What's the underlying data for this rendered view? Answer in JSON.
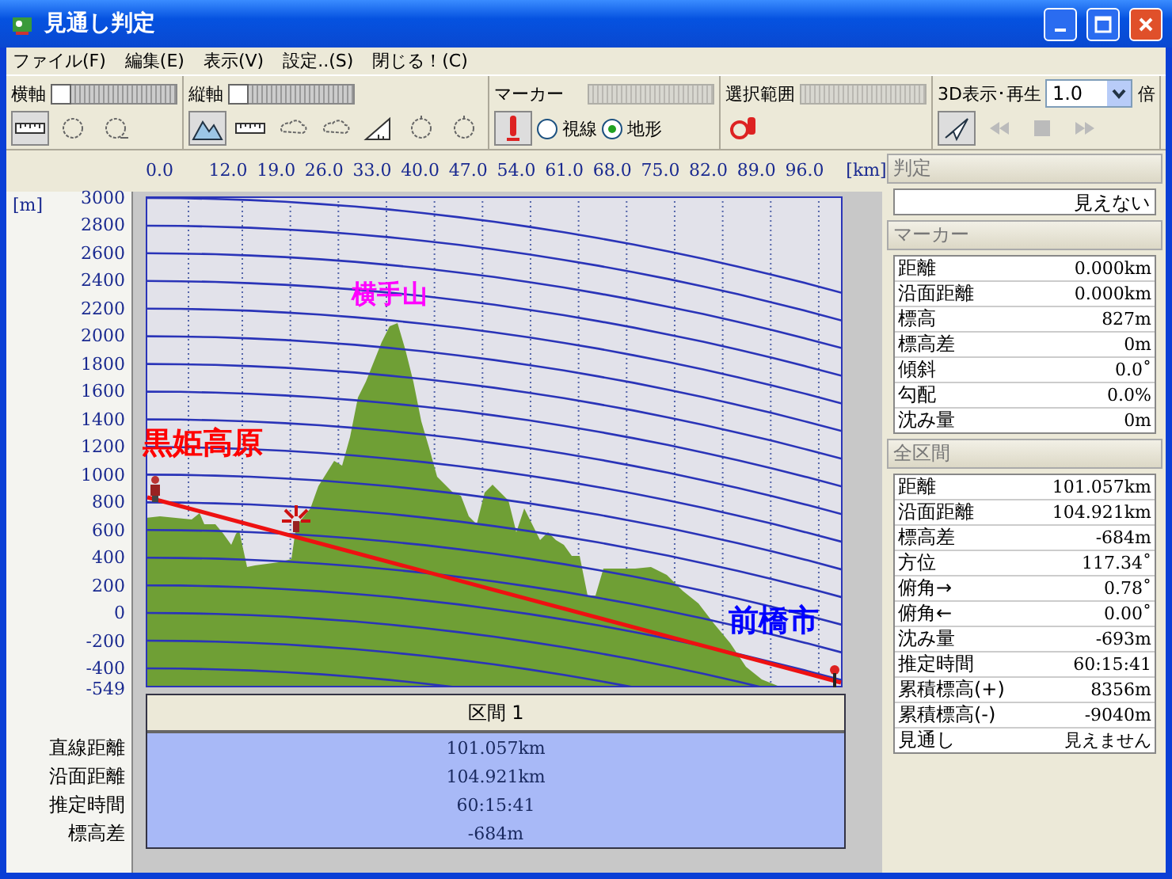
{
  "window": {
    "title": "見通し判定"
  },
  "menu": [
    {
      "label": "ファイル(F)"
    },
    {
      "label": "編集(E)"
    },
    {
      "label": "表示(V)"
    },
    {
      "label": "設定..(S)"
    },
    {
      "label": "閉じる！(C)"
    }
  ],
  "toolbar": {
    "horizontal_axis": {
      "label": "横軸",
      "level": 0
    },
    "vertical_axis": {
      "label": "縦軸",
      "level": 0
    },
    "marker": {
      "label": "マーカー",
      "disabled": true,
      "options": [
        {
          "label": "視線",
          "selected": false
        },
        {
          "label": "地形",
          "selected": true
        }
      ]
    },
    "selection": {
      "label": "選択範囲",
      "disabled": true
    },
    "playback": {
      "label": "3D表示･再生",
      "speed": "1.0",
      "unit": "倍"
    }
  },
  "profile": {
    "x_ticks": [
      "0.0",
      "12.0",
      "19.0",
      "26.0",
      "33.0",
      "40.0",
      "47.0",
      "54.0",
      "61.0",
      "68.0",
      "75.0",
      "82.0",
      "89.0",
      "96.0"
    ],
    "x_unit": "[km]",
    "y_unit": "[m]",
    "y_ticks": [
      "3000",
      "2800",
      "2600",
      "2400",
      "2200",
      "2000",
      "1800",
      "1600",
      "1400",
      "1200",
      "1000",
      "800",
      "600",
      "400",
      "200",
      "0",
      "-200",
      "-400",
      "-549"
    ],
    "place_labels": [
      {
        "kind": "peak",
        "text": "横手山",
        "color": "#ff00ff"
      },
      {
        "kind": "start",
        "text": "黒姫高原",
        "color": "#ff0000"
      },
      {
        "kind": "end",
        "text": "前橋市",
        "color": "#0000ff"
      }
    ]
  },
  "section_table": {
    "header": "区間 1",
    "rows": [
      {
        "label": "直線距離",
        "value": "101.057km"
      },
      {
        "label": "沿面距離",
        "value": "104.921km"
      },
      {
        "label": "推定時間",
        "value": "60:15:41"
      },
      {
        "label": "標高差",
        "value": "-684m"
      }
    ]
  },
  "side_panel": {
    "judgement": {
      "title": "判定",
      "value": "見えない"
    },
    "marker": {
      "title": "マーカー",
      "rows": [
        {
          "label": "距離",
          "value": "0.000km"
        },
        {
          "label": "沿面距離",
          "value": "0.000km"
        },
        {
          "label": "標高",
          "value": "827m"
        },
        {
          "label": "標高差",
          "value": "0m"
        },
        {
          "label": "傾斜",
          "value": "0.0˚"
        },
        {
          "label": "勾配",
          "value": "0.0%"
        },
        {
          "label": "沈み量",
          "value": "0m"
        }
      ]
    },
    "total": {
      "title": "全区間",
      "rows": [
        {
          "label": "距離",
          "value": "101.057km"
        },
        {
          "label": "沿面距離",
          "value": "104.921km"
        },
        {
          "label": "標高差",
          "value": "-684m"
        },
        {
          "label": "方位",
          "value": "117.34˚"
        },
        {
          "label": "俯角→",
          "value": "0.78˚"
        },
        {
          "label": "俯角←",
          "value": "0.00˚"
        },
        {
          "label": "沈み量",
          "value": "-693m"
        },
        {
          "label": "推定時間",
          "value": "60:15:41"
        },
        {
          "label": "累積標高(+)",
          "value": "8356m"
        },
        {
          "label": "累積標高(-)",
          "value": "-9040m"
        },
        {
          "label": "見通し",
          "value": "見えません"
        }
      ]
    }
  }
}
